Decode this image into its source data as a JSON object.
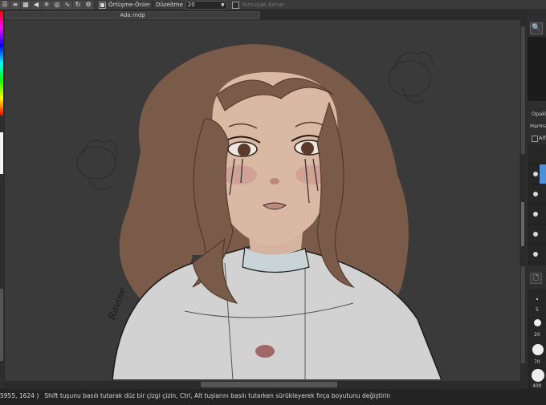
{
  "toolbar": {
    "icons": [
      "menu-icon",
      "layers-icon",
      "grid-icon",
      "arrow-left-icon",
      "burst-icon",
      "concentric-circles-icon",
      "curve-icon",
      "rotate-icon",
      "gear-icon"
    ],
    "overlap_checkbox": {
      "checked": true,
      "label": "Örtüşme-Önler"
    },
    "correction_label": "Düzeltme",
    "correction_value": "20",
    "soft_edge_checkbox": {
      "checked": false,
      "label": "Yumuşak Kenar"
    }
  },
  "document_tab": {
    "title": "Ada.mdp"
  },
  "canvas": {
    "artwork": "digital portrait drawing",
    "signature_text": "Ravine"
  },
  "statusbar": {
    "coordinates": "5955, 1624 )",
    "hint": "Shift tuşunu basılı tutarak düz bir çizgi çizin, Ctrl, Alt tuşlarını basılı tutarken sürükleyerek fırça boyutunu değiştirin"
  },
  "right_panel": {
    "opacity_label": "Opakl",
    "blend_label": "Harma",
    "alpha_label": "Alf",
    "layers": [
      {
        "visible": true,
        "selected": true
      },
      {
        "visible": true,
        "selected": false
      },
      {
        "visible": true,
        "selected": false
      },
      {
        "visible": true,
        "selected": false
      },
      {
        "visible": true,
        "selected": false
      }
    ],
    "brush_sizes": [
      "5",
      "20",
      "70",
      "400"
    ]
  },
  "colors": {
    "accent": "#4d8fd9",
    "canvas_bg": "#3a3a3a",
    "hair": "#7a5a48",
    "skin": "#d9b8a4"
  }
}
